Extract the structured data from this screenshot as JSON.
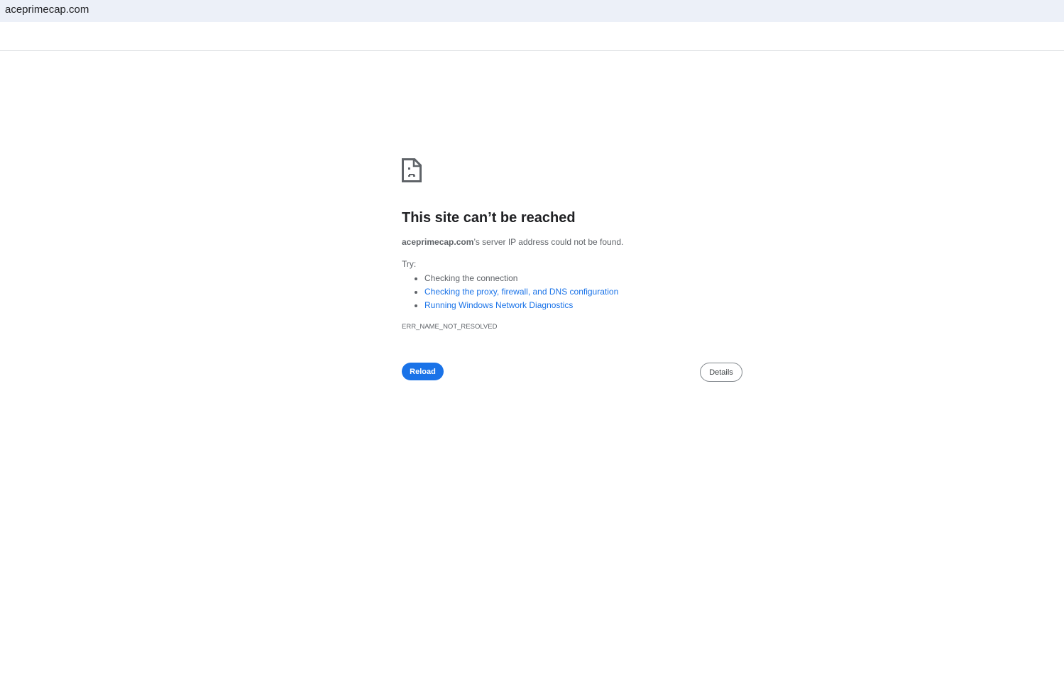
{
  "address_bar": {
    "url": "aceprimecap.com"
  },
  "error": {
    "icon": "sad-page-icon",
    "title": "This site can’t be reached",
    "domain": "aceprimecap.com",
    "message": "’s server IP address could not be found.",
    "try_label": "Try:",
    "suggestions": [
      "Checking the connection",
      "Checking the proxy, firewall, and DNS configuration",
      "Running Windows Network Diagnostics"
    ],
    "code": "ERR_NAME_NOT_RESOLVED",
    "reload_label": "Reload",
    "details_label": "Details"
  }
}
